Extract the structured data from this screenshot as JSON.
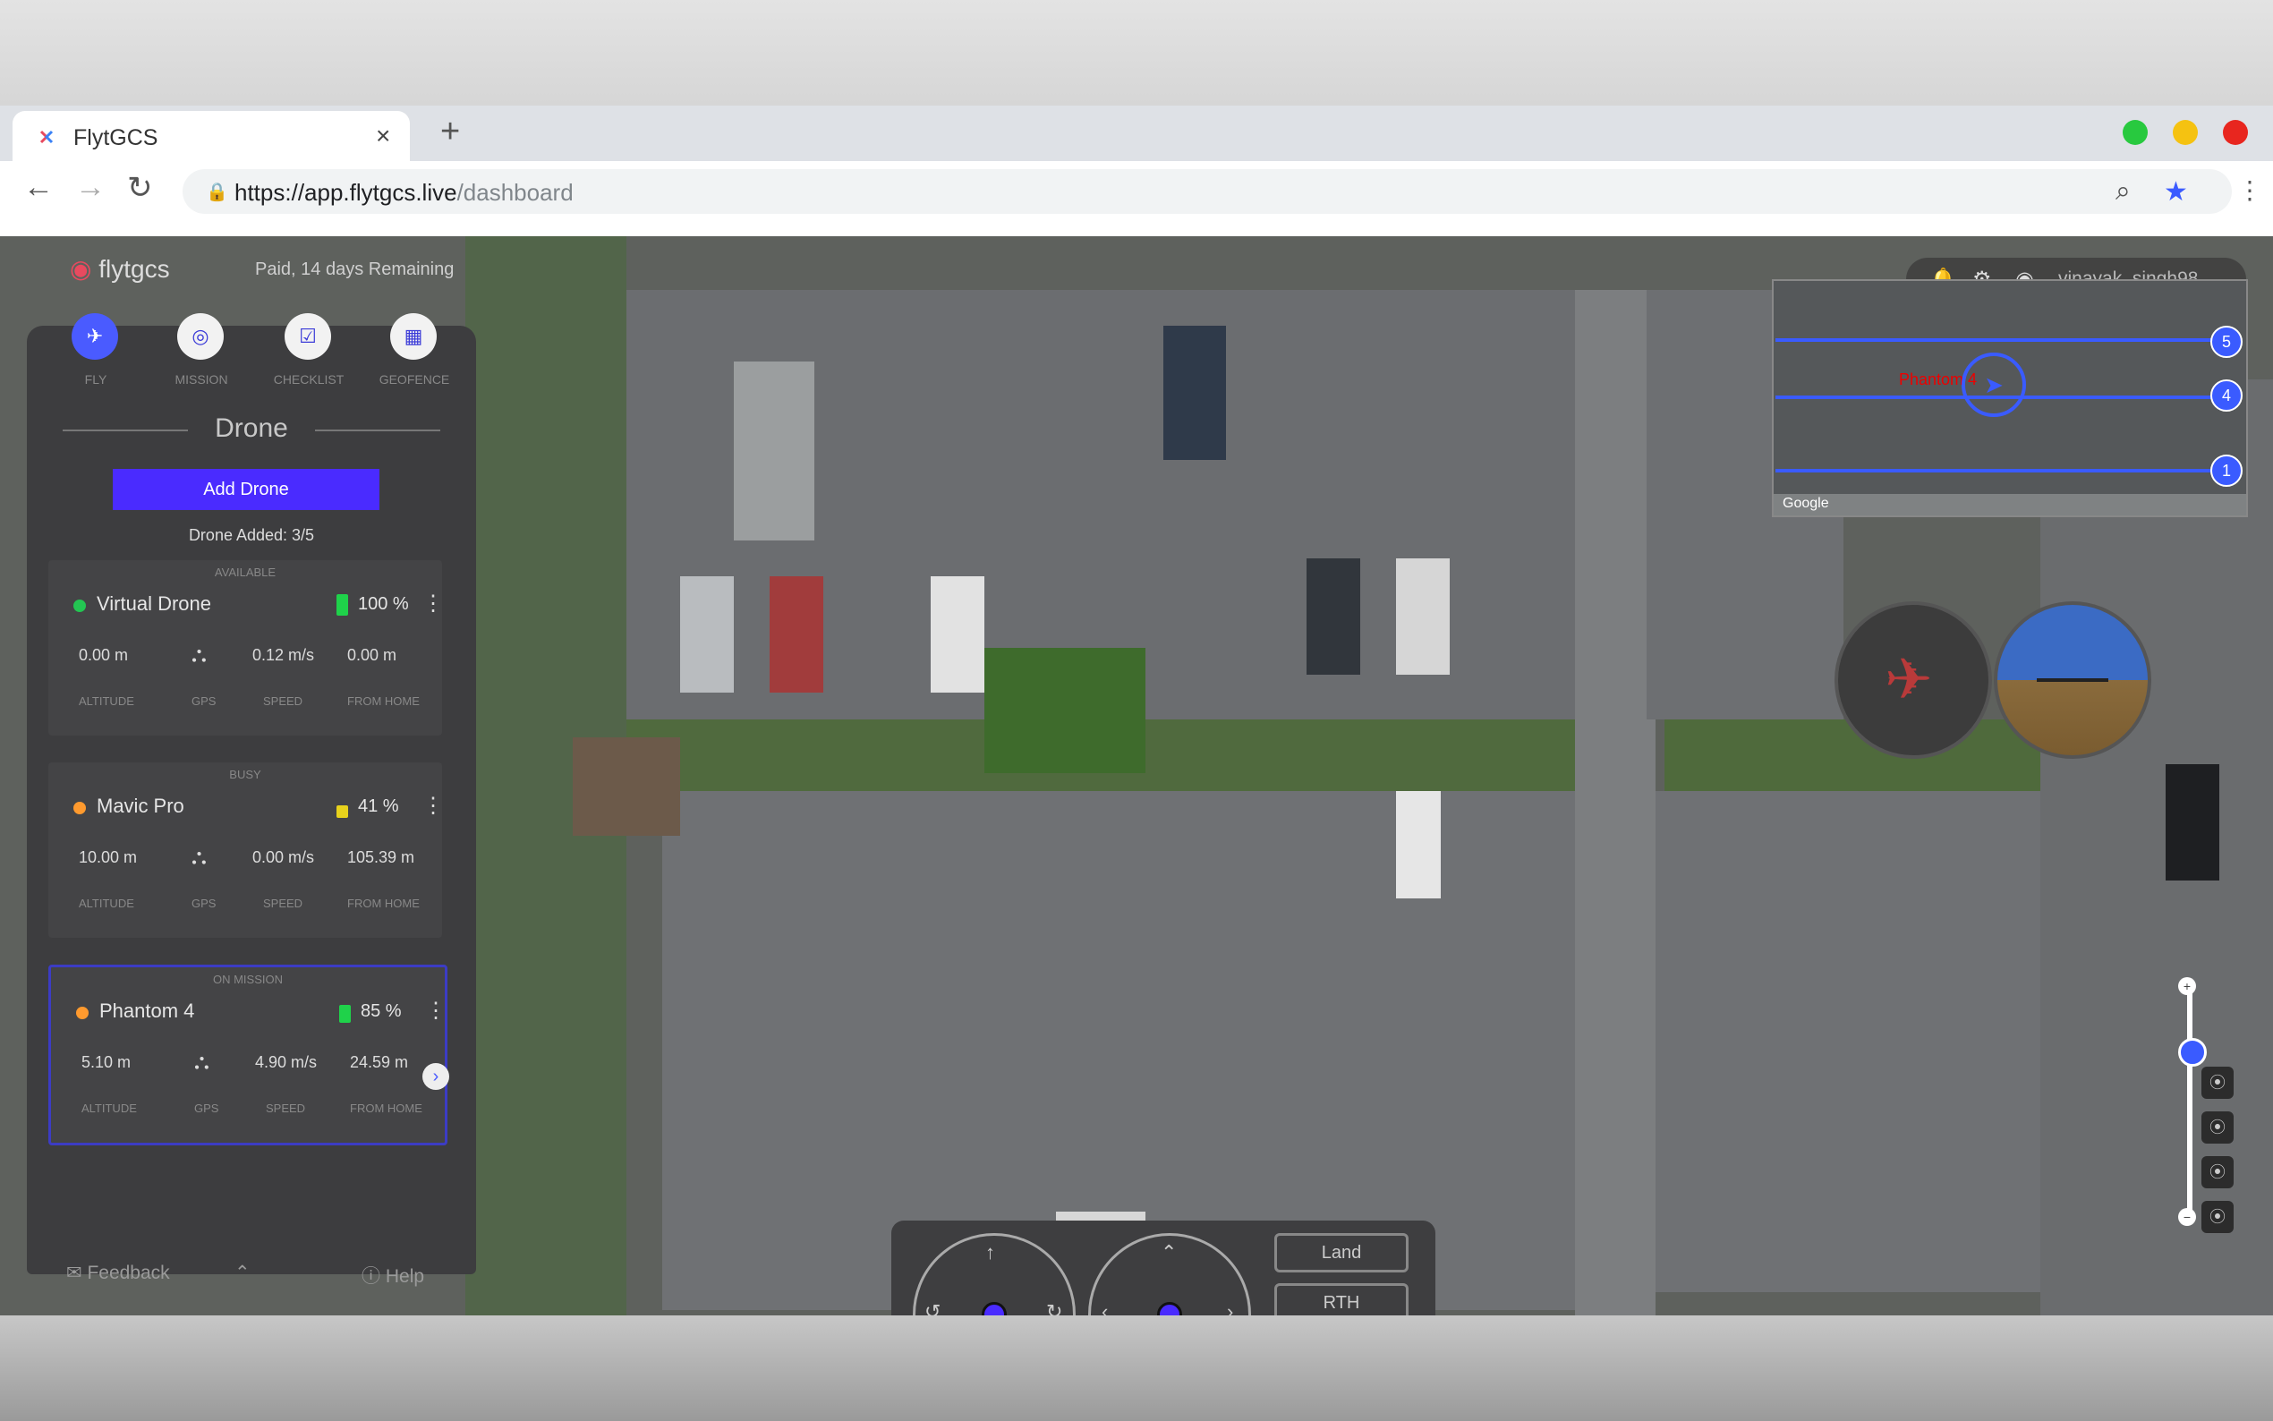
{
  "browser": {
    "tab_title": "FlytGCS",
    "tab_close": "×",
    "new_tab": "+",
    "url_main": "https://app.flytgcs.live",
    "url_path": "/dashboard"
  },
  "app": {
    "brand": "flytgcs",
    "plan_status": "Paid, 14 days Remaining",
    "nav": [
      {
        "label": "FLY"
      },
      {
        "label": "MISSION"
      },
      {
        "label": "CHECKLIST"
      },
      {
        "label": "GEOFENCE"
      }
    ],
    "section_title": "Drone",
    "add_drone_label": "Add Drone",
    "drones_added": "Drone Added: 3/5",
    "stat_labels": [
      "ALTITUDE",
      "GPS",
      "SPEED",
      "FROM HOME"
    ],
    "drones": [
      {
        "status": "AVAILABLE",
        "name": "Virtual Drone",
        "dot_color": "#23c552",
        "battery": "100 %",
        "battery_color": "#1fd24a",
        "altitude": "0.00 m",
        "speed": "0.12 m/s",
        "from_home": "0.00 m"
      },
      {
        "status": "BUSY",
        "name": "Mavic Pro",
        "dot_color": "#ff9a2e",
        "battery": "41 %",
        "battery_color": "#e8d21c",
        "altitude": "10.00 m",
        "speed": "0.00 m/s",
        "from_home": "105.39 m"
      },
      {
        "status": "ON MISSION",
        "name": "Phantom 4",
        "dot_color": "#ff9a2e",
        "battery": "85 %",
        "battery_color": "#1fd24a",
        "altitude": "5.10 m",
        "speed": "4.90 m/s",
        "from_home": "24.59 m"
      }
    ],
    "feedback_label": "Feedback",
    "help_label": "Help",
    "username": "vinayak_singh98",
    "minimap": {
      "drone_label": "Phantom 4",
      "waypoints": [
        "5",
        "4",
        "1"
      ],
      "google": "Google"
    },
    "controls": {
      "land_label": "Land",
      "rth_label": "RTH"
    }
  },
  "colors": {
    "accent": "#4a2bff",
    "route": "#3a5bff",
    "panel": "#3d3d3f"
  }
}
